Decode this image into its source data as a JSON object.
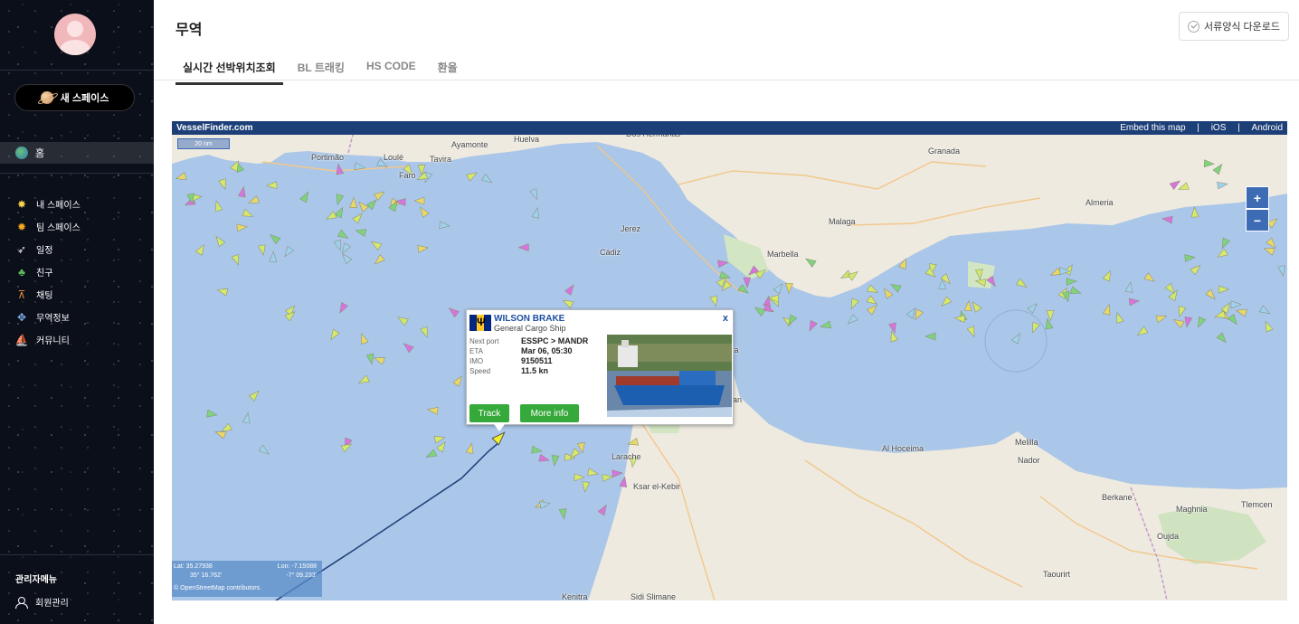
{
  "sidebar": {
    "new_space_label": "새 스페이스",
    "home_label": "홈",
    "items": [
      {
        "label": "내 스페이스",
        "icon": "star-icon",
        "glyph": "✸",
        "color": "#f7d44a"
      },
      {
        "label": "팀 스페이스",
        "icon": "sun-icon",
        "glyph": "✹",
        "color": "#f5a623"
      },
      {
        "label": "일정",
        "icon": "rocket-icon",
        "glyph": "➶",
        "color": "#e9e9f0"
      },
      {
        "label": "친구",
        "icon": "alien-icon",
        "glyph": "♣",
        "color": "#5fbf5b"
      },
      {
        "label": "채팅",
        "icon": "telescope-icon",
        "glyph": "⊼",
        "color": "#e48a3a"
      },
      {
        "label": "무역정보",
        "icon": "satellite-icon",
        "glyph": "✥",
        "color": "#7fb0e8"
      },
      {
        "label": "커뮤니티",
        "icon": "spaceship-icon",
        "glyph": "⛵",
        "color": "#b9c3d8"
      }
    ],
    "admin_title": "관리자메뉴",
    "admin_item": "회원관리"
  },
  "header": {
    "title": "무역",
    "download_label": "서류양식 다운로드"
  },
  "tabs": [
    {
      "label": "실시간 선박위치조회",
      "active": true
    },
    {
      "label": "BL 트래킹",
      "active": false
    },
    {
      "label": "HS CODE",
      "active": false
    },
    {
      "label": "환율",
      "active": false
    }
  ],
  "map": {
    "brand": "VesselFinder.com",
    "embed": "Embed this map",
    "sep": "|",
    "ios": "iOS",
    "android": "Android",
    "zoom_in": "+",
    "zoom_out": "−",
    "scale": "20 nm",
    "lat_label": "Lat: 35.27938",
    "lat_dms": "35°  16.762'",
    "lon_label": "Lon: -7.15088",
    "lon_dms": "-7°  09.233'",
    "attribution": "© OpenStreetMap contributors.",
    "places": {
      "huelva": "Huelva",
      "ayamonte": "Ayamonte",
      "portimao": "Portimão",
      "loule": "Loulé",
      "tavira": "Tavira",
      "faro": "Faro",
      "dos_hermanas": "Dos Hermanas",
      "granada": "Granada",
      "jerez": "Jerez",
      "cadiz": "Cádiz",
      "malaga": "Malaga",
      "almeria": "Almeria",
      "marbella": "Marbella",
      "ceuta": "uta",
      "tetouan": "an",
      "al_hoceima": "Al Hoceima",
      "melilla": "Melilla",
      "nador": "Nador",
      "larache": "Larache",
      "ksar": "Ksar el-Kebir",
      "berkane": "Berkane",
      "tlemcen": "Tlemcen",
      "maghnia": "Maghnia",
      "oujda": "Oujda",
      "taourirt": "Taourirt",
      "kenitra": "Kenitra",
      "sidi_slimane": "Sidi Slimane"
    },
    "popup": {
      "name": "WILSON BRAKE",
      "type": "General Cargo Ship",
      "close": "x",
      "next_port_label": "Next port",
      "next_port": "ESSPC > MANDR",
      "eta_label": "ETA",
      "eta": "Mar 06, 05:30",
      "imo_label": "IMO",
      "imo": "9150511",
      "speed_label": "Speed",
      "speed": "11.5 kn",
      "track_label": "Track",
      "more_label": "More info"
    }
  }
}
